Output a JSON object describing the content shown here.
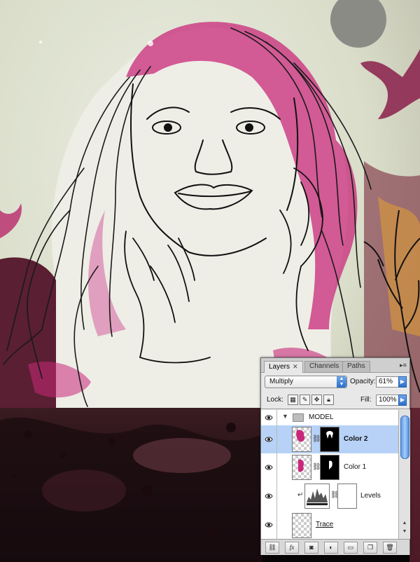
{
  "panel": {
    "tabs": [
      {
        "label": "Layers",
        "active": true
      },
      {
        "label": "Channels",
        "active": false
      },
      {
        "label": "Paths",
        "active": false
      }
    ],
    "blend_mode": "Multiply",
    "opacity_label": "Opacity:",
    "opacity_value": "61%",
    "lock_label": "Lock:",
    "fill_label": "Fill:",
    "fill_value": "100%",
    "layers": [
      {
        "name": "MODEL",
        "type": "group",
        "selected": false
      },
      {
        "name": "Color 2",
        "type": "layer-with-mask",
        "selected": true
      },
      {
        "name": "Color 1",
        "type": "layer-with-mask",
        "selected": false
      },
      {
        "name": "Levels",
        "type": "adjustment",
        "selected": false
      },
      {
        "name": "Trace",
        "type": "layer",
        "selected": false
      }
    ],
    "footer_icons": [
      "link-icon",
      "fx-icon",
      "add-mask-icon",
      "adjustment-icon",
      "folder-icon",
      "new-layer-icon",
      "trash-icon"
    ]
  },
  "colors": {
    "selection": "#b7d2f6",
    "accent": "#2b6fcf",
    "magenta": "#c8287a"
  }
}
